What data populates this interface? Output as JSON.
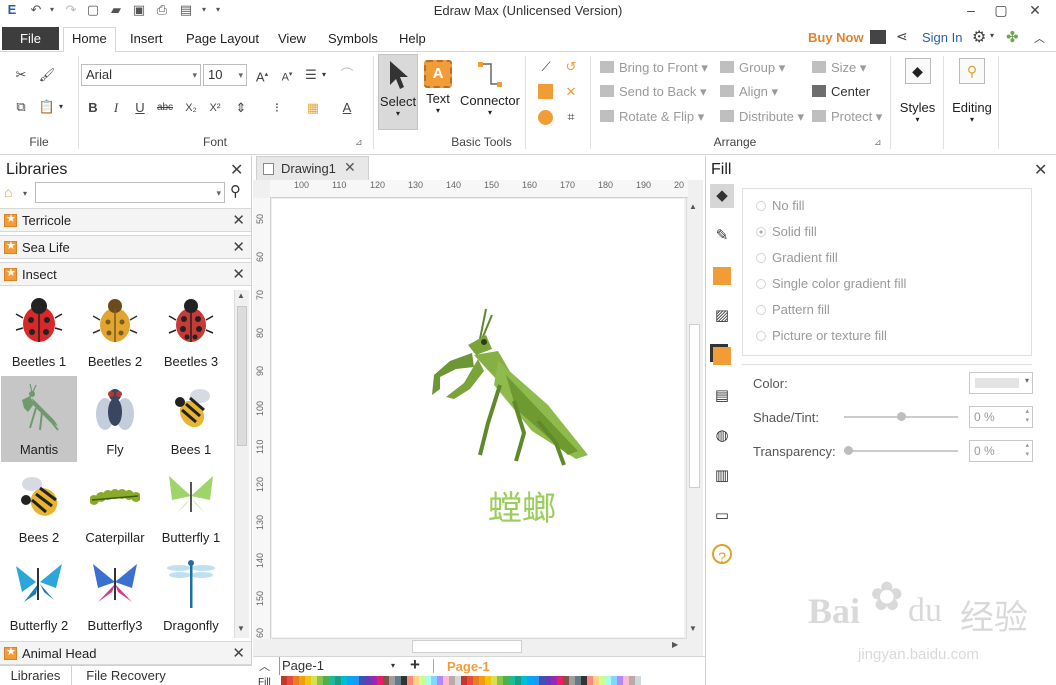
{
  "window": {
    "title": "Edraw Max (Unlicensed Version)"
  },
  "menu": {
    "tabs": [
      "File",
      "Home",
      "Insert",
      "Page Layout",
      "View",
      "Symbols",
      "Help"
    ],
    "buy_now": "Buy Now",
    "sign_in": "Sign In"
  },
  "ribbon": {
    "file_group": "File",
    "font_group": "Font",
    "font_name": "Arial",
    "font_size": "10",
    "basic_tools_group": "Basic Tools",
    "select": "Select",
    "text": "Text",
    "connector": "Connector",
    "arrange_group": "Arrange",
    "bring_to_front": "Bring to Front",
    "send_to_back": "Send to Back",
    "rotate_flip": "Rotate & Flip",
    "group": "Group",
    "align": "Align",
    "distribute": "Distribute",
    "size": "Size",
    "center": "Center",
    "protect": "Protect",
    "styles": "Styles",
    "editing": "Editing"
  },
  "libraries": {
    "title": "Libraries",
    "categories": [
      "Terricole",
      "Sea Life",
      "Insect"
    ],
    "last_category": "Animal Head",
    "shapes": [
      {
        "label": "Beetles 1"
      },
      {
        "label": "Beetles 2"
      },
      {
        "label": "Beetles 3"
      },
      {
        "label": "Mantis"
      },
      {
        "label": "Fly"
      },
      {
        "label": "Bees 1"
      },
      {
        "label": "Bees 2"
      },
      {
        "label": "Caterpillar"
      },
      {
        "label": "Butterfly 1"
      },
      {
        "label": "Butterfly 2"
      },
      {
        "label": "Butterfly3"
      },
      {
        "label": "Dragonfly"
      }
    ],
    "bottom_tabs": [
      "Libraries",
      "File Recovery"
    ]
  },
  "document": {
    "tab": "Drawing1",
    "ruler_h": [
      "100",
      "110",
      "120",
      "130",
      "140",
      "150",
      "160",
      "170",
      "180",
      "190",
      "20"
    ],
    "ruler_v": [
      "50",
      "60",
      "70",
      "80",
      "90",
      "100",
      "110",
      "120",
      "130",
      "140",
      "150",
      "60"
    ],
    "caption": "螳螂",
    "caption_color": "#9acd5a",
    "page_select": "Page-1",
    "active_page": "Page-1",
    "fill_cut": "Fill"
  },
  "fill_panel": {
    "title": "Fill",
    "options": [
      "No fill",
      "Solid fill",
      "Gradient fill",
      "Single color gradient fill",
      "Pattern fill",
      "Picture or texture fill"
    ],
    "color_label": "Color:",
    "shade_label": "Shade/Tint:",
    "shade_value": "0 %",
    "transparency_label": "Transparency:",
    "transparency_value": "0 %"
  },
  "watermark": {
    "brand": "Bai",
    "brand2": "经验",
    "url": "jingyan.baidu.com"
  },
  "colors": {
    "accent": "#f29c38",
    "file_tab": "#3d3d3d",
    "selected_shape": "#c6c6c6"
  }
}
